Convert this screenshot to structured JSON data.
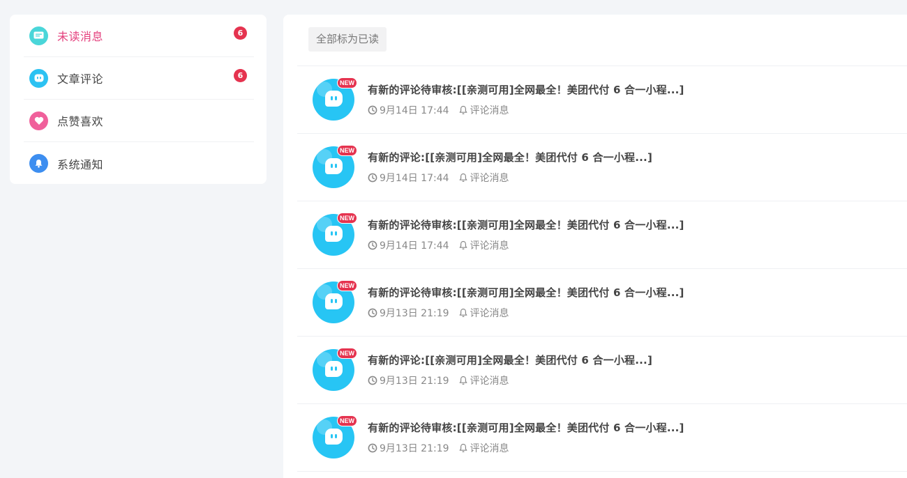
{
  "sidebar": {
    "items": [
      {
        "label": "未读消息",
        "badge": "6",
        "icon": "unread-message-icon",
        "color": "#4ad6d9",
        "active": true
      },
      {
        "label": "文章评论",
        "badge": "6",
        "icon": "comment-icon",
        "color": "#2cc2f2",
        "active": false
      },
      {
        "label": "点赞喜欢",
        "badge": "",
        "icon": "heart-icon",
        "color": "#f0609b",
        "active": false
      },
      {
        "label": "系统通知",
        "badge": "",
        "icon": "bell-icon",
        "color": "#3d8ef0",
        "active": false
      }
    ]
  },
  "toolbar": {
    "mark_all_label": "全部标为已读"
  },
  "messages": [
    {
      "title": "有新的评论待审核:[[亲测可用]全网最全！美团代付 6 合一小程...]",
      "time": "9月14日 17:44",
      "category": "评论消息",
      "tag": "NEW"
    },
    {
      "title": "有新的评论:[[亲测可用]全网最全！美团代付 6 合一小程...]",
      "time": "9月14日 17:44",
      "category": "评论消息",
      "tag": "NEW"
    },
    {
      "title": "有新的评论待审核:[[亲测可用]全网最全！美团代付 6 合一小程...]",
      "time": "9月14日 17:44",
      "category": "评论消息",
      "tag": "NEW"
    },
    {
      "title": "有新的评论待审核:[[亲测可用]全网最全！美团代付 6 合一小程...]",
      "time": "9月13日 21:19",
      "category": "评论消息",
      "tag": "NEW"
    },
    {
      "title": "有新的评论:[[亲测可用]全网最全！美团代付 6 合一小程...]",
      "time": "9月13日 21:19",
      "category": "评论消息",
      "tag": "NEW"
    },
    {
      "title": "有新的评论待审核:[[亲测可用]全网最全！美团代付 6 合一小程...]",
      "time": "9月13日 21:19",
      "category": "评论消息",
      "tag": "NEW"
    }
  ],
  "colors": {
    "accent": "#e4407d",
    "badge": "#e5334f",
    "avatar": "#27c5f4"
  }
}
